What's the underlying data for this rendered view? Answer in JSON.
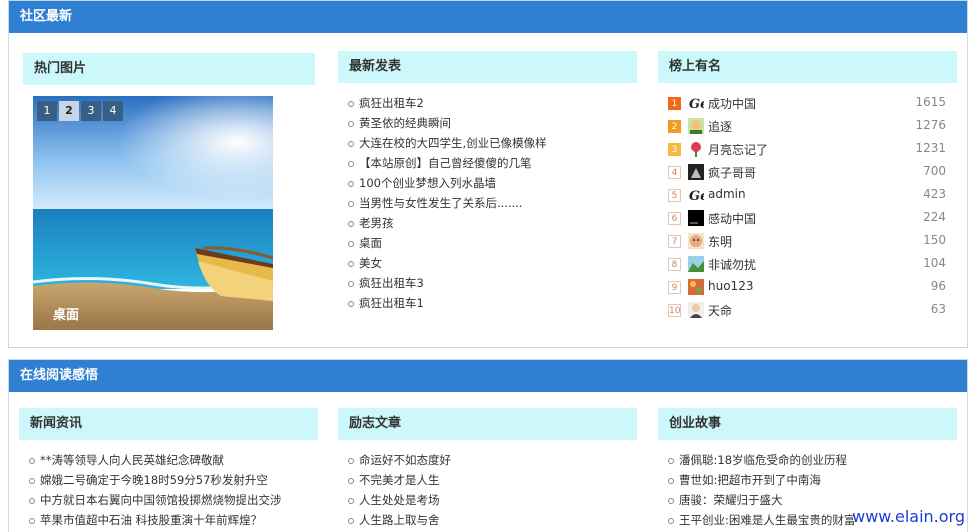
{
  "community": {
    "title": "社区最新",
    "hot_pics": {
      "title": "热门图片",
      "pages": [
        "1",
        "2",
        "3",
        "4"
      ],
      "active_page": 2,
      "caption": "桌面"
    },
    "latest": {
      "title": "最新发表",
      "items": [
        "疯狂出租车2",
        "黄圣依的经典瞬间",
        "大连在校的大四学生,创业已像模像样",
        "【本站原创】自己曾经傻傻的几笔",
        "100个创业梦想入列水晶墙",
        "当男性与女性发生了关系后.......",
        "老男孩",
        "桌面",
        "美女",
        "疯狂出租车3",
        "疯狂出租车1"
      ]
    },
    "ranking": {
      "title": "榜上有名",
      "items": [
        {
          "rank": "1",
          "name": "成功中国",
          "value": "1615",
          "avatar": "logo-icon"
        },
        {
          "rank": "2",
          "name": "追逐",
          "value": "1276",
          "avatar": "cartoon-avatar"
        },
        {
          "rank": "3",
          "name": "月亮忘记了",
          "value": "1231",
          "avatar": "flower-avatar"
        },
        {
          "rank": "4",
          "name": "疯子哥哥",
          "value": "700",
          "avatar": "dark-avatar"
        },
        {
          "rank": "5",
          "name": "admin",
          "value": "423",
          "avatar": "logo-icon"
        },
        {
          "rank": "6",
          "name": "感动中国",
          "value": "224",
          "avatar": "black-avatar"
        },
        {
          "rank": "7",
          "name": "东明",
          "value": "150",
          "avatar": "face-avatar"
        },
        {
          "rank": "8",
          "name": "非诚勿扰",
          "value": "104",
          "avatar": "landscape-avatar"
        },
        {
          "rank": "9",
          "name": "huo123",
          "value": "96",
          "avatar": "pattern-avatar"
        },
        {
          "rank": "10",
          "name": "天命",
          "value": "63",
          "avatar": "person-avatar"
        }
      ]
    }
  },
  "reading": {
    "title": "在线阅读感悟",
    "news": {
      "title": "新闻资讯",
      "items": [
        "**涛等领导人向人民英雄纪念碑敬献",
        "嫦娥二号确定于今晚18时59分57秒发射升空",
        "中方就日本右翼向中国领馆投掷燃烧物提出交涉",
        "苹果市值超中石油 科技股重演十年前辉煌？"
      ]
    },
    "inspire": {
      "title": "励志文章",
      "items": [
        "命运好不如态度好",
        "不完美才是人生",
        "人生处处是考场",
        "人生路上取与舍"
      ]
    },
    "startup": {
      "title": "创业故事",
      "items": [
        "潘佩聪:18岁临危受命的创业历程",
        "曹世如:把超市开到了中南海",
        "唐骏：荣耀归于盛大",
        "王平创业:困难是人生最宝贵的财富"
      ]
    }
  },
  "watermark": "www.elain.org",
  "colors": {
    "header_bg": "#2f7fd3",
    "col_title_bg": "#cdf8fb",
    "watermark": "#1a3fd3"
  }
}
